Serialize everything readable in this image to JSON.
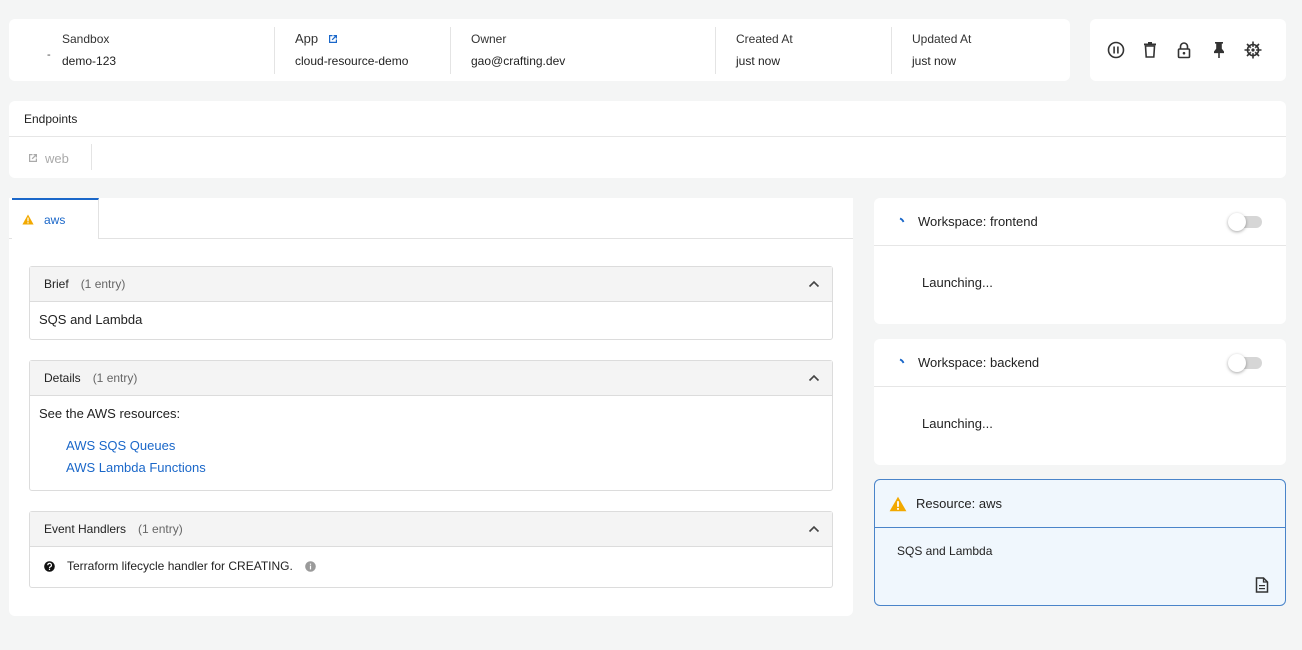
{
  "header": {
    "sandbox_label": "Sandbox",
    "sandbox_value": "demo-123",
    "dash": "-",
    "app_label": "App",
    "app_value": "cloud-resource-demo",
    "owner_label": "Owner",
    "owner_value": "gao@crafting.dev",
    "created_label": "Created At",
    "created_value": "just now",
    "updated_label": "Updated At",
    "updated_value": "just now"
  },
  "actions": [
    "pause-icon",
    "delete-icon",
    "lock-icon",
    "pin-icon",
    "helm-icon"
  ],
  "endpoints": {
    "title": "Endpoints",
    "items": [
      {
        "label": "web",
        "icon": "external-link-icon"
      }
    ]
  },
  "main": {
    "tab_label": "aws",
    "sections": [
      {
        "title": "Brief",
        "count": "(1 entry)",
        "body": "SQS and Lambda"
      },
      {
        "title": "Details",
        "count": "(1 entry)",
        "body": "See the AWS resources:",
        "links": [
          "AWS SQS Queues",
          "AWS Lambda Functions"
        ]
      },
      {
        "title": "Event Handlers",
        "count": "(1 entry)",
        "body": "Terraform lifecycle handler for CREATING."
      }
    ]
  },
  "workspaces": [
    {
      "title": "Workspace: frontend",
      "status": "Launching..."
    },
    {
      "title": "Workspace: backend",
      "status": "Launching..."
    }
  ],
  "resource": {
    "title": "Resource: aws",
    "brief": "SQS and Lambda"
  },
  "colors": {
    "accent": "#1a67c9",
    "warning": "#f2a900",
    "resource_bg": "#f0f7fd"
  }
}
